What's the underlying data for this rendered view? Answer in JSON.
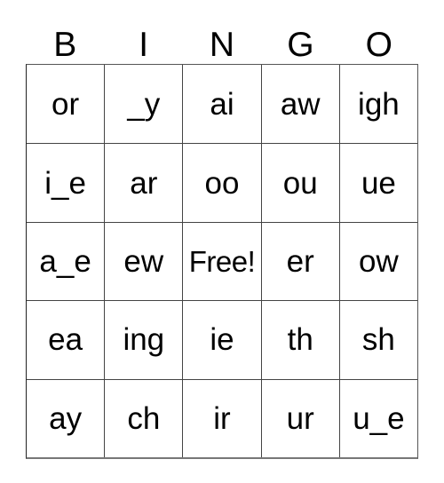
{
  "card": {
    "headers": [
      "B",
      "I",
      "N",
      "G",
      "O"
    ],
    "rows": [
      {
        "cells": [
          {
            "text": "or",
            "free": false
          },
          {
            "text": "_y",
            "free": false
          },
          {
            "text": "ai",
            "free": false
          },
          {
            "text": "aw",
            "free": false
          },
          {
            "text": "igh",
            "free": false
          }
        ]
      },
      {
        "cells": [
          {
            "text": "i_e",
            "free": false
          },
          {
            "text": "ar",
            "free": false
          },
          {
            "text": "oo",
            "free": false
          },
          {
            "text": "ou",
            "free": false
          },
          {
            "text": "ue",
            "free": false
          }
        ]
      },
      {
        "cells": [
          {
            "text": "a_e",
            "free": false
          },
          {
            "text": "ew",
            "free": false
          },
          {
            "text": "Free!",
            "free": true
          },
          {
            "text": "er",
            "free": false
          },
          {
            "text": "ow",
            "free": false
          }
        ]
      },
      {
        "cells": [
          {
            "text": "ea",
            "free": false
          },
          {
            "text": "ing",
            "free": false
          },
          {
            "text": "ie",
            "free": false
          },
          {
            "text": "th",
            "free": false
          },
          {
            "text": "sh",
            "free": false
          }
        ]
      },
      {
        "cells": [
          {
            "text": "ay",
            "free": false
          },
          {
            "text": "ch",
            "free": false
          },
          {
            "text": "ir",
            "free": false
          },
          {
            "text": "ur",
            "free": false
          },
          {
            "text": "u_e",
            "free": false
          }
        ]
      }
    ],
    "colors": {
      "background": "#ffffff",
      "text": "#000000",
      "grid_line": "#444444"
    }
  }
}
